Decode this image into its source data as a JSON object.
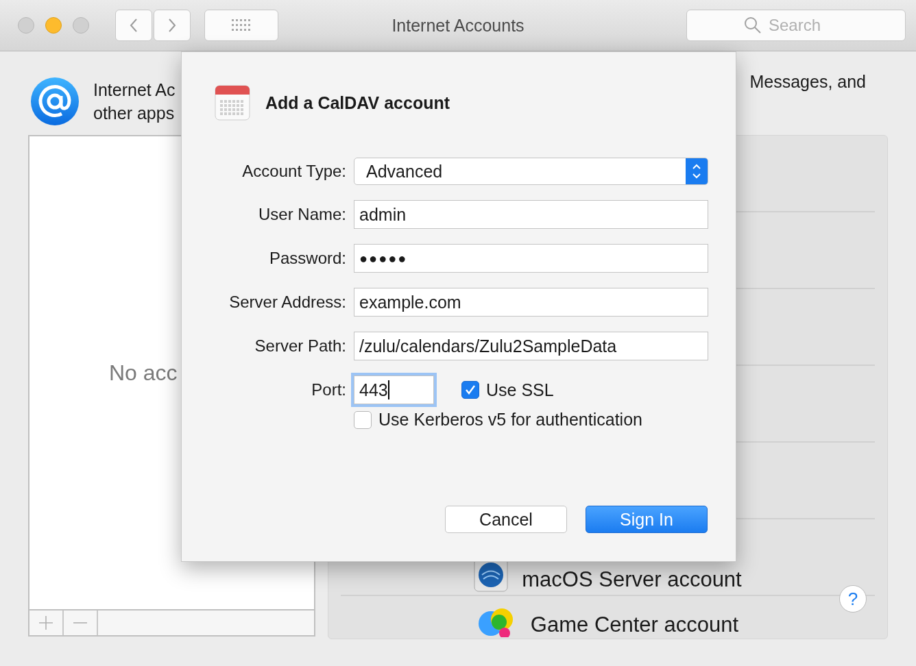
{
  "window": {
    "title": "Internet Accounts",
    "search": {
      "placeholder": "Search"
    }
  },
  "header": {
    "lines": [
      "Internet Ac",
      "other apps"
    ],
    "right_text": "Messages, and"
  },
  "accounts_list": {
    "empty_text": "No acc"
  },
  "services": [
    {
      "name": "macOS Server account",
      "kind": "server"
    },
    {
      "name": "Game Center account",
      "kind": "gamecenter"
    }
  ],
  "help_button": "?",
  "dialog": {
    "title": "Add a CalDAV account",
    "fields": [
      {
        "label": "Account Type:",
        "kind": "popup",
        "value": "Advanced"
      },
      {
        "label": "User Name:",
        "kind": "text",
        "value": "admin"
      },
      {
        "label": "Password:",
        "kind": "password",
        "value": "●●●●●"
      },
      {
        "label": "Server Address:",
        "kind": "text",
        "value": "example.com"
      },
      {
        "label": "Server Path:",
        "kind": "text",
        "value": "/zulu/calendars/Zulu2SampleData"
      }
    ],
    "port": {
      "label": "Port:",
      "value": "443",
      "focused": true
    },
    "checkboxes": [
      {
        "label": "Use SSL",
        "checked": true
      },
      {
        "label": "Use Kerberos v5 for authentication",
        "checked": false
      }
    ],
    "buttons": [
      {
        "label": "Cancel",
        "default": false
      },
      {
        "label": "Sign In",
        "default": true
      }
    ]
  }
}
